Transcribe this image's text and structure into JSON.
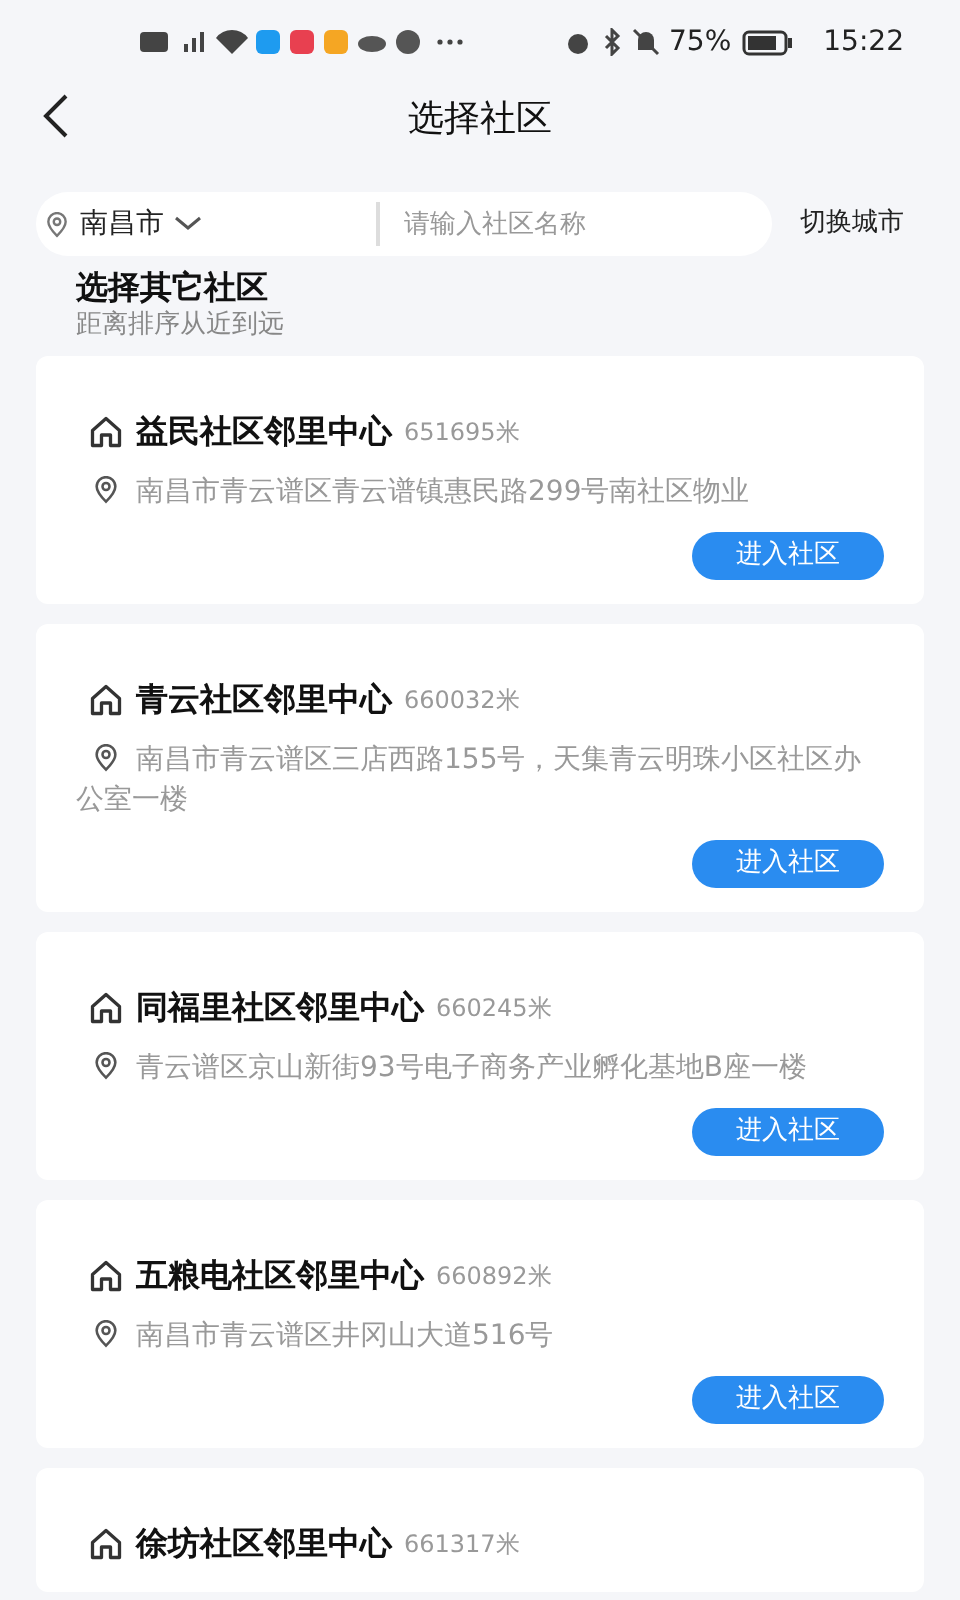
{
  "status_bar": {
    "battery": "75%",
    "time": "15:22"
  },
  "header": {
    "title": "选择社区"
  },
  "search": {
    "city": "南昌市",
    "placeholder": "请输入社区名称",
    "switch_city": "切换城市"
  },
  "section": {
    "title": "选择其它社区",
    "subtitle": "距离排序从近到远"
  },
  "communities": [
    {
      "name": "益民社区邻里中心",
      "distance": "651695米",
      "address": "南昌市青云谱区青云谱镇惠民路299号南社区物业",
      "button": "进入社区"
    },
    {
      "name": "青云社区邻里中心",
      "distance": "660032米",
      "address": "南昌市青云谱区三店西路155号，天集青云明珠小区社区办公室一楼",
      "button": "进入社区"
    },
    {
      "name": "同福里社区邻里中心",
      "distance": "660245米",
      "address": "青云谱区京山新街93号电子商务产业孵化基地B座一楼",
      "button": "进入社区"
    },
    {
      "name": "五粮电社区邻里中心",
      "distance": "660892米",
      "address": "南昌市青云谱区井冈山大道516号",
      "button": "进入社区"
    },
    {
      "name": "徐坊社区邻里中心",
      "distance": "661317米"
    }
  ]
}
